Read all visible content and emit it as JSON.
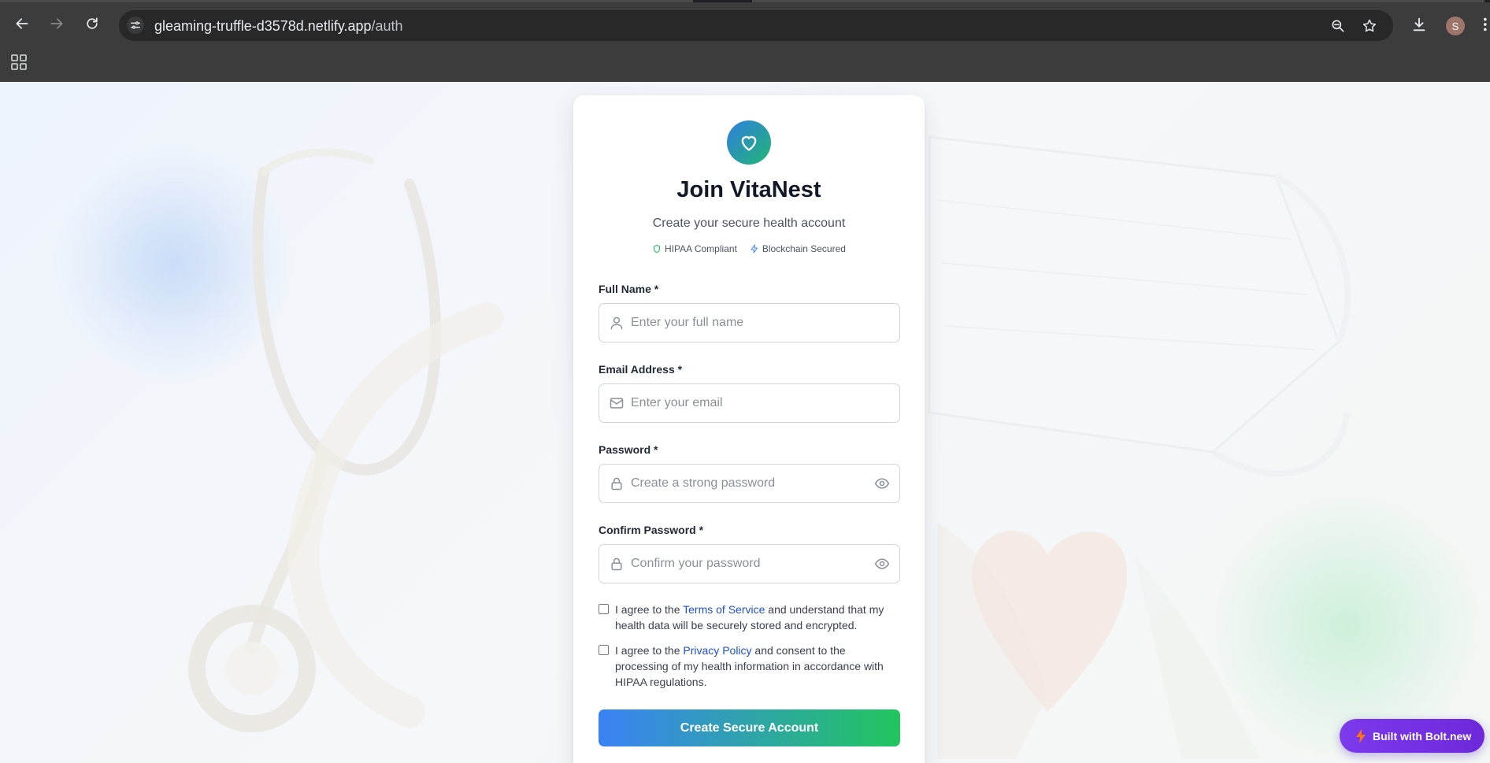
{
  "browser": {
    "url_host": "gleaming-truffle-d3578d.netlify.app",
    "url_path": "/auth",
    "profile_initial": "S"
  },
  "card": {
    "title": "Join VitaNest",
    "subtitle": "Create your secure health account",
    "badges": {
      "hipaa": "HIPAA Compliant",
      "blockchain": "Blockchain Secured"
    }
  },
  "form": {
    "full_name": {
      "label": "Full Name *",
      "placeholder": "Enter your full name",
      "value": ""
    },
    "email": {
      "label": "Email Address *",
      "placeholder": "Enter your email",
      "value": ""
    },
    "password": {
      "label": "Password *",
      "placeholder": "Create a strong password",
      "value": ""
    },
    "confirm_password": {
      "label": "Confirm Password *",
      "placeholder": "Confirm your password",
      "value": ""
    },
    "terms": {
      "prefix": "I agree to the ",
      "link": "Terms of Service",
      "suffix": " and understand that my health data will be securely stored and encrypted.",
      "checked": false
    },
    "privacy": {
      "prefix": "I agree to the ",
      "link": "Privacy Policy",
      "suffix": " and consent to the processing of my health information in accordance with HIPAA regulations.",
      "checked": false
    },
    "submit_label": "Create Secure Account"
  },
  "bolt_badge": {
    "label": "Built with Bolt.new"
  },
  "colors": {
    "primary_blue": "#3b82f6",
    "primary_green": "#22c55e",
    "link": "#1d4ed8",
    "bolt_purple": "#7c3aed"
  },
  "icons": {
    "logo": "heart-icon",
    "hipaa": "shield-icon",
    "blockchain": "lightning-icon",
    "full_name": "user-icon",
    "email": "mail-icon",
    "password": "lock-icon",
    "toggle": "eye-icon"
  }
}
